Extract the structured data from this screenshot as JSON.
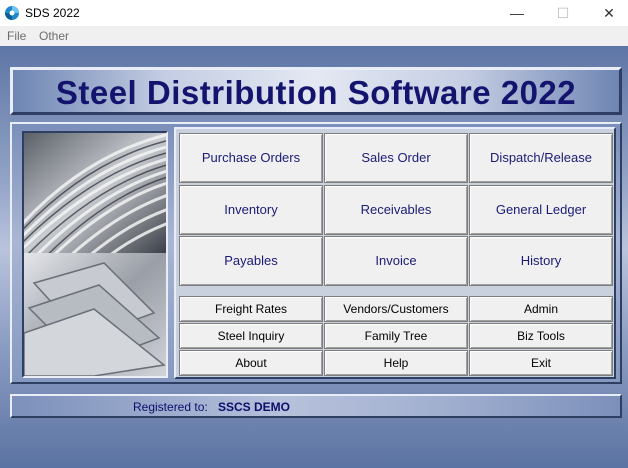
{
  "window": {
    "title": "SDS 2022",
    "icon": "app-swirl-icon",
    "minimize_glyph": "—",
    "maximize_glyph": "☐",
    "close_glyph": "✕"
  },
  "menu": [
    "File",
    "Other"
  ],
  "banner": {
    "title": "Steel Distribution Software 2022"
  },
  "main_buttons": [
    [
      "Purchase Orders",
      "Sales Order",
      "Dispatch/Release"
    ],
    [
      "Inventory",
      "Receivables",
      "General Ledger"
    ],
    [
      "Payables",
      "Invoice",
      "History"
    ]
  ],
  "secondary_buttons": [
    [
      "Freight Rates",
      "Vendors/Customers",
      "Admin"
    ],
    [
      "Steel Inquiry",
      "Family Tree",
      "Biz Tools"
    ],
    [
      "About",
      "Help",
      "Exit"
    ]
  ],
  "status": {
    "label": "Registered to:",
    "value": "SSCS DEMO"
  },
  "colors": {
    "accent_text": "#14146e",
    "background": "#6a7fa8"
  }
}
